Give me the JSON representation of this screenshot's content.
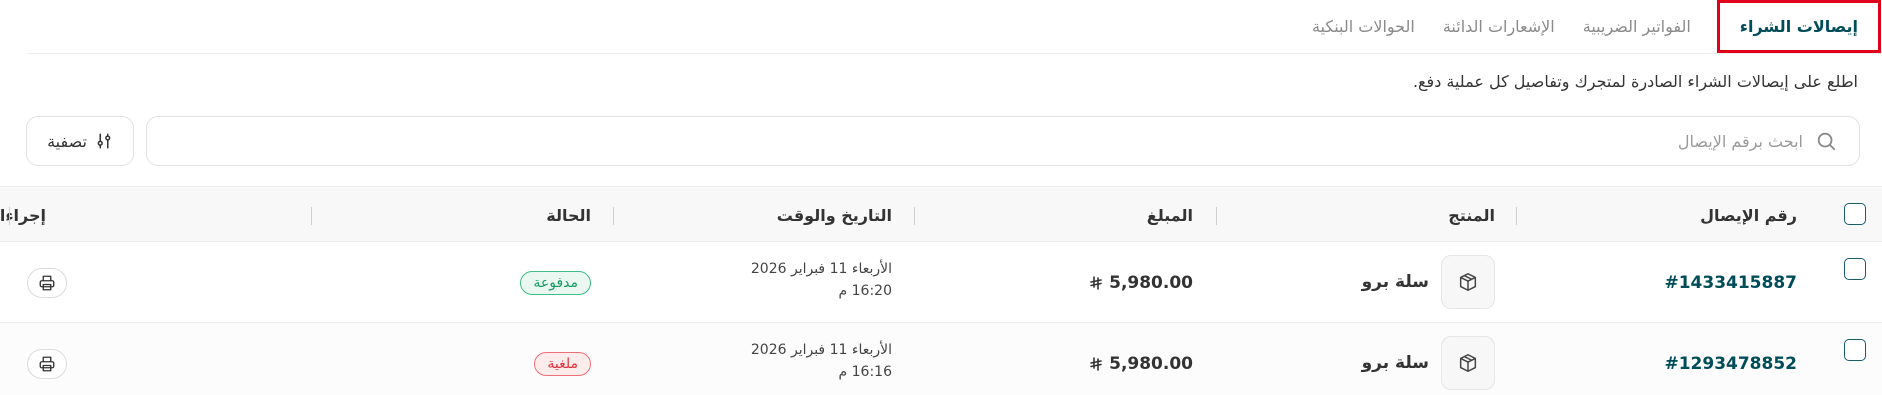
{
  "tabs": [
    {
      "label": "إيصالات الشراء",
      "active": true
    },
    {
      "label": "الفواتير الضريبية",
      "active": false
    },
    {
      "label": "الإشعارات الدائنة",
      "active": false
    },
    {
      "label": "الحوالات البنكية",
      "active": false
    }
  ],
  "description": "اطلع على إيصالات الشراء الصادرة لمتجرك وتفاصيل كل عملية دفع.",
  "search": {
    "placeholder": "ابحث برقم الإيصال",
    "value": "",
    "icon": "search-icon"
  },
  "filter": {
    "label": "تصفية",
    "icon": "sliders-icon"
  },
  "table": {
    "columns": [
      "رقم الإيصال",
      "المنتج",
      "المبلغ",
      "التاريخ والوقت",
      "الحالة",
      "إجراءات"
    ],
    "rows": [
      {
        "receipt": "#1433415887",
        "product": "سلة برو",
        "amount": "5,980.00",
        "date_line1": "الأربعاء 11 فبراير 2026",
        "date_line2": "16:20 م",
        "status": "مدفوعة",
        "status_type": "paid"
      },
      {
        "receipt": "#1293478852",
        "product": "سلة برو",
        "amount": "5,980.00",
        "date_line1": "الأربعاء 11 فبراير 2026",
        "date_line2": "16:16 م",
        "status": "ملغية",
        "status_type": "cancelled"
      }
    ]
  },
  "colors": {
    "accent": "#004d5a",
    "paid": "#169b63",
    "cancelled": "#e0323c",
    "highlight": "#e0001b"
  }
}
